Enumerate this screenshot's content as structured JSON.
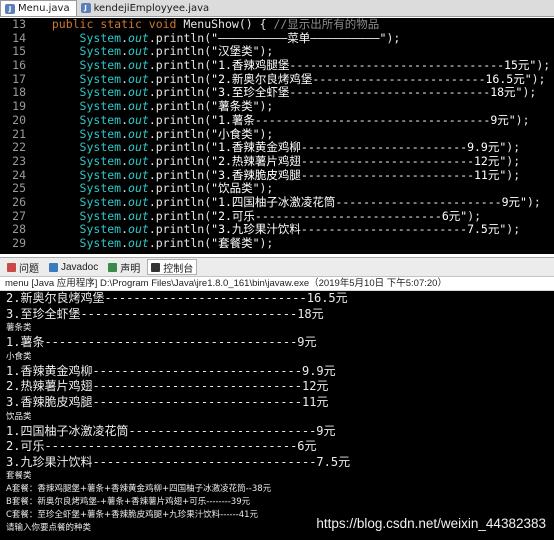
{
  "editor_tabs": [
    {
      "label": "Menu.java",
      "active": true
    },
    {
      "label": "kendejiEmployyee.java",
      "active": false
    }
  ],
  "code_lines": [
    {
      "num": "13",
      "kind": "method",
      "kw": "public static void ",
      "name": "MenuShow",
      "rest": "() {",
      "comment": "//显示出所有的物品"
    },
    {
      "num": "14",
      "kind": "println",
      "str": "\"——————————菜单——————————\""
    },
    {
      "num": "15",
      "kind": "println",
      "str": "\"汉堡类\""
    },
    {
      "num": "16",
      "kind": "println",
      "str": "\"1.香辣鸡腿堡-------------------------------15元\""
    },
    {
      "num": "17",
      "kind": "println",
      "str": "\"2.新奥尔良烤鸡堡-------------------------16.5元\""
    },
    {
      "num": "18",
      "kind": "println",
      "str": "\"3.至珍全虾堡-----------------------------18元\""
    },
    {
      "num": "19",
      "kind": "println",
      "str": "\"薯条类\""
    },
    {
      "num": "20",
      "kind": "println",
      "str": "\"1.薯条----------------------------------9元\""
    },
    {
      "num": "21",
      "kind": "println",
      "str": "\"小食类\""
    },
    {
      "num": "22",
      "kind": "println",
      "str": "\"1.香辣黄金鸡柳------------------------9.9元\""
    },
    {
      "num": "23",
      "kind": "println",
      "str": "\"2.热辣薯片鸡翅-------------------------12元\""
    },
    {
      "num": "24",
      "kind": "println",
      "str": "\"3.香辣脆皮鸡腿-------------------------11元\""
    },
    {
      "num": "25",
      "kind": "println",
      "str": "\"饮品类\""
    },
    {
      "num": "26",
      "kind": "println",
      "str": "\"1.四国柚子冰激凌花筒------------------------9元\""
    },
    {
      "num": "27",
      "kind": "println",
      "str": "\"2.可乐---------------------------6元\""
    },
    {
      "num": "28",
      "kind": "println",
      "str": "\"3.九珍果汁饮料------------------------7.5元\""
    },
    {
      "num": "29",
      "kind": "println",
      "str": "\"套餐类\""
    }
  ],
  "code_tokens": {
    "system": "System",
    "dot": ".",
    "out": "out",
    "println": "println(",
    "close": ");"
  },
  "view_tabs": [
    {
      "label": "问题",
      "icon": "problems-icon",
      "color": "#c94a4a",
      "active": false
    },
    {
      "label": "Javadoc",
      "icon": "javadoc-icon",
      "color": "#3a7abf",
      "active": false
    },
    {
      "label": "声明",
      "icon": "declaration-icon",
      "color": "#3a8a4a",
      "active": false
    },
    {
      "label": "控制台",
      "icon": "console-icon",
      "color": "#333333",
      "active": true
    }
  ],
  "console_header": "menu [Java 应用程序] D:\\Program Files\\Java\\jre1.8.0_161\\bin\\javaw.exe（2019年5月10日 下午5:07:20）",
  "console_lines": [
    {
      "text": "2.新奥尔良烤鸡堡----------------------------16.5元",
      "size": "big"
    },
    {
      "text": "3.至珍全虾堡------------------------------18元",
      "size": "big"
    },
    {
      "text": "薯条类",
      "size": "small"
    },
    {
      "text": "1.薯条-----------------------------------9元",
      "size": "big"
    },
    {
      "text": "小食类",
      "size": "small"
    },
    {
      "text": "1.香辣黄金鸡柳-----------------------------9.9元",
      "size": "big"
    },
    {
      "text": "2.热辣薯片鸡翅-----------------------------12元",
      "size": "big"
    },
    {
      "text": "3.香辣脆皮鸡腿-----------------------------11元",
      "size": "big"
    },
    {
      "text": "饮品类",
      "size": "small"
    },
    {
      "text": "1.四国柚子冰激凌花筒--------------------------9元",
      "size": "big"
    },
    {
      "text": "2.可乐-----------------------------------6元",
      "size": "big"
    },
    {
      "text": "3.九珍果汁饮料-------------------------------7.5元",
      "size": "big"
    },
    {
      "text": "套餐类",
      "size": "small"
    },
    {
      "text": "A套餐：香辣鸡腿堡+薯条+香辣黄金鸡柳+四国柚子冰激凌花筒--38元",
      "size": "small"
    },
    {
      "text": "B套餐：新奥尔良烤鸡堡-+薯条+香辣薯片鸡翅+可乐--------39元",
      "size": "small"
    },
    {
      "text": "C套餐：至珍全虾堡+薯条+香辣脆皮鸡腿+九珍果汁饮料------41元",
      "size": "small"
    },
    {
      "text": "请输入你要点餐的种类",
      "size": "small"
    }
  ],
  "watermark": "https://blog.csdn.net/weixin_44382383",
  "colors": {
    "editor_bg": "#000000",
    "keyword": "#cc7832",
    "system": "#2ec8c8",
    "string": "#ffffff",
    "comment": "#8c8c8c"
  }
}
